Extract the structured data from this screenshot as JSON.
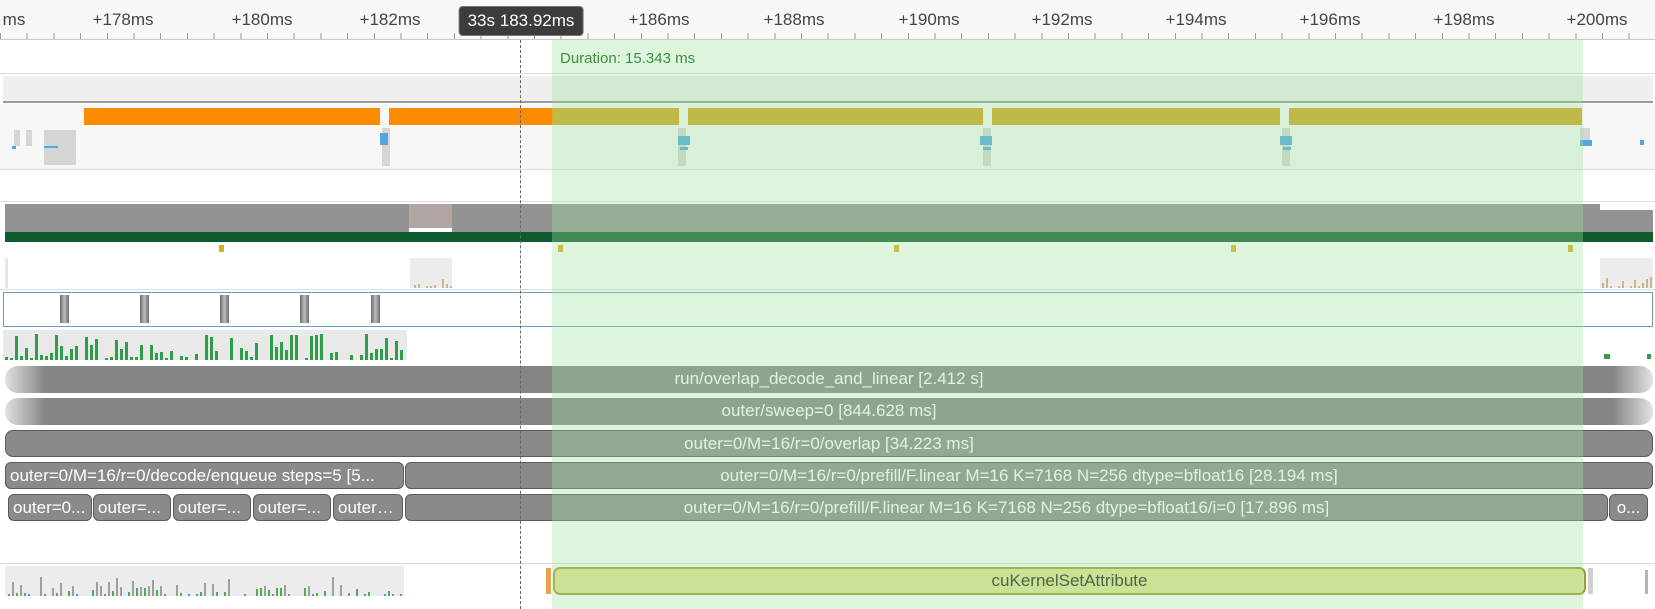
{
  "ruler": {
    "ticks": [
      {
        "id": "t0",
        "label": "ms"
      },
      {
        "id": "t1",
        "label": "+178ms"
      },
      {
        "id": "t2",
        "label": "+180ms"
      },
      {
        "id": "t3",
        "label": "+182ms"
      },
      {
        "id": "t4",
        "label": "+186ms"
      },
      {
        "id": "t5",
        "label": "+188ms"
      },
      {
        "id": "t6",
        "label": "+190ms"
      },
      {
        "id": "t7",
        "label": "+192ms"
      },
      {
        "id": "t8",
        "label": "+194ms"
      },
      {
        "id": "t9",
        "label": "+196ms"
      },
      {
        "id": "t10",
        "label": "+198ms"
      },
      {
        "id": "t11",
        "label": "+200ms"
      }
    ],
    "cursor_time": "33s 183.92ms"
  },
  "selection": {
    "duration_label": "Duration: 15.343 ms"
  },
  "slices": {
    "s1": "run/overlap_decode_and_linear [2.412 s]",
    "s2": "outer/sweep=0 [844.628 ms]",
    "s3": "outer=0/M=16/r=0/overlap [34.223 ms]",
    "s4a": "outer=0/M=16/r=0/decode/enqueue steps=5 [5...",
    "s4b": "outer=0/M=16/r=0/prefill/F.linear M=16 K=7168 N=256 dtype=bfloat16 [28.194 ms]",
    "s5a": "outer=0...",
    "s5b": "outer=...",
    "s5c": "outer=...",
    "s5d": "outer=...",
    "s5e": "outer=...",
    "s5f": "outer=0/M=16/r=0/prefill/F.linear M=16 K=7168 N=256 dtype=bfloat16/i=0 [17.896 ms]",
    "s5g": "o..."
  },
  "kernel": {
    "label": "cuKernelSetAttribute"
  },
  "colors": {
    "selection": "#9ee29e",
    "orange": "#fb8c00",
    "gold": "#d4a21e",
    "slice_gray": "#8a8a8a",
    "kernel_fill": "#e4e08e",
    "counter_green": "#2e9e48",
    "track_dark_green": "#0e5b2d"
  }
}
